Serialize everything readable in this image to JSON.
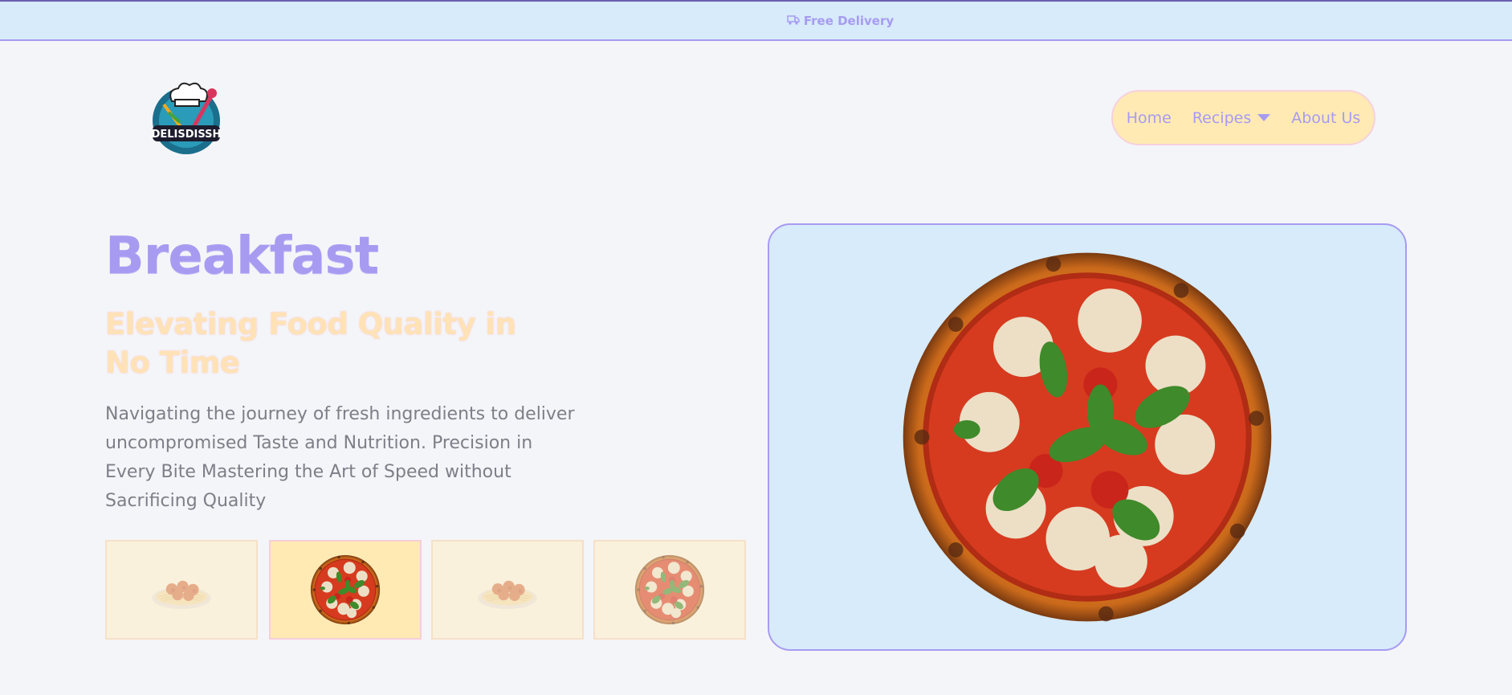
{
  "announcement": {
    "icon": "truck-icon",
    "text": "Free Delivery"
  },
  "logo": {
    "text": "DELISDISSH",
    "icon": "chef-hat-icon"
  },
  "nav": {
    "items": [
      {
        "label": "Home"
      },
      {
        "label": "Recipes",
        "icon": "caret-down-icon"
      },
      {
        "label": "About Us"
      }
    ]
  },
  "hero": {
    "title": "Breakfast",
    "subtitle": "Elevating Food Quality in No Time",
    "description": "Navigating the journey of fresh ingredients to deliver uncompromised Taste and Nutrition. Precision in Every Bite Mastering the Art of Speed without Sacrificing Quality"
  },
  "thumbnails": [
    {
      "image": "spaghetti-meatballs",
      "selected": false
    },
    {
      "image": "margherita-pizza",
      "selected": true
    },
    {
      "image": "spaghetti-meatballs",
      "selected": false
    },
    {
      "image": "margherita-pizza",
      "selected": false
    }
  ],
  "featured_image": "margherita-pizza",
  "colors": {
    "accent": "#a79bf1",
    "cream": "#ffeab4",
    "sky": "#d7ebfa",
    "background": "#f4f5f8",
    "text_muted": "#7d7f88"
  }
}
